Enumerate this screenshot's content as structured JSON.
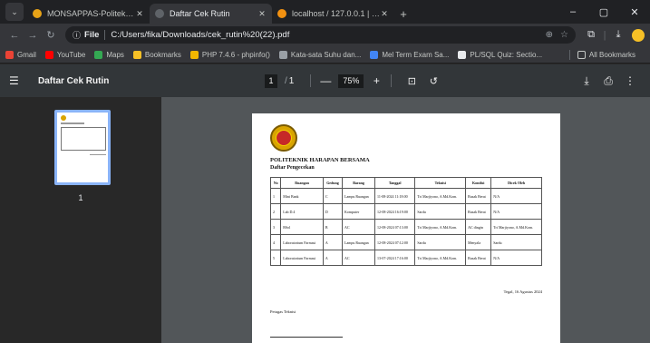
{
  "browser": {
    "tabs": [
      {
        "title": "MONSAPPAS-Politeknik Haras",
        "color": "#e8a317",
        "active": false
      },
      {
        "title": "Daftar Cek Rutin",
        "color": "#5f6368",
        "active": true
      },
      {
        "title": "localhost / 127.0.0.1 | phpMyA",
        "color": "#f29111",
        "active": false
      }
    ],
    "new_tab": "+",
    "window_controls": [
      "–",
      "▢",
      "✕"
    ],
    "address": {
      "scheme": "File",
      "url": "C:/Users/fika/Downloads/cek_rutin%20(22).pdf"
    },
    "bookmarks": [
      {
        "label": "Gmail",
        "color": "#ea4335"
      },
      {
        "label": "YouTube",
        "color": "#ff0000"
      },
      {
        "label": "Maps",
        "color": "#34a853"
      },
      {
        "label": "Bookmarks",
        "color": "#f6c026"
      },
      {
        "label": "PHP 7.4.6 - phpinfo()",
        "color": "#f2b600"
      },
      {
        "label": "Kata-sata Suhu dan...",
        "color": "#9aa0a6"
      },
      {
        "label": "Mel Term Exam Sa...",
        "color": "#4285f4"
      },
      {
        "label": "PL/SQL Quiz: Sectio...",
        "color": "#e8eaed"
      }
    ],
    "all_bookmarks": "All Bookmarks"
  },
  "pdf": {
    "title": "Daftar Cek Rutin",
    "page_current": "1",
    "page_sep": "/",
    "page_total": "1",
    "zoom": "75%",
    "zoom_out": "—",
    "zoom_in": "+",
    "thumbnail_number": "1"
  },
  "document": {
    "institution": "POLITEKNIK HARAPAN BERSAMA",
    "title": "Daftar Pengecekan",
    "columns": [
      "No",
      "Ruangan",
      "Gedung",
      "Barang",
      "Tanggal",
      "Teknisi",
      "Kondisi",
      "Dicek Oleh"
    ],
    "rows": [
      [
        "1",
        "Mini Bank",
        "C",
        "Lampu Ruangan",
        "11-08-2024 11:18:00",
        "Tri Marjiyono, A.Md.Kom.",
        "Rusak Berat",
        "N/A"
      ],
      [
        "2",
        "Lab D.4",
        "D",
        "Komputer",
        "12-08-2024 16:19:00",
        "Sardu",
        "Rusak Berat",
        "N/A"
      ],
      [
        "3",
        "RSol",
        "B",
        "AC",
        "12-08-2024 07:13:00",
        "Tri Marjiyono, A.Md.Kom.",
        "AC dingin",
        "Tri Marjiyono, A.Md.Kom."
      ],
      [
        "4",
        "Laboratorium Farmasi",
        "A",
        "Lampu Ruangan",
        "12-08-2024 07:12:00",
        "Sardu",
        "Menyala",
        "Sardu"
      ],
      [
        "5",
        "Laboratorium Farmasi",
        "A",
        "AC",
        "13-07-2024 17:16:00",
        "Tri Marjiyono, A.Md.Kom.",
        "Rusak Berat",
        "N/A"
      ]
    ],
    "place_date": "Tegal, 16 Agustus 2024",
    "sign_label": "Petugas Teknisi"
  },
  "colors": {
    "pdf_toolbar": "#323639",
    "viewer_bg": "#525659",
    "thumb_highlight": "#8ab4f8"
  }
}
